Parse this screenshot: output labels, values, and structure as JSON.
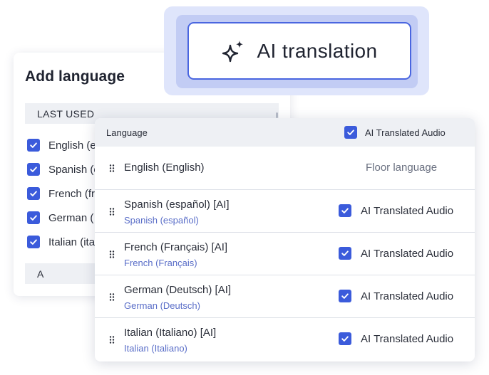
{
  "add_language": {
    "title": "Add language",
    "last_used_header": "LAST USED",
    "alpha_header": "A",
    "items": [
      {
        "label": "English (e",
        "checked": true
      },
      {
        "label": "Spanish (e",
        "checked": true
      },
      {
        "label": "French (fr",
        "checked": true
      },
      {
        "label": "German (",
        "checked": true
      },
      {
        "label": "Italian (ita",
        "checked": true
      }
    ]
  },
  "ai_badge": {
    "label": "AI translation",
    "icon": "sparkle-icon"
  },
  "table": {
    "header": {
      "language": "Language",
      "audio": "AI Translated Audio",
      "audio_checked": true
    },
    "floor_row": {
      "name": "English (English)",
      "status": "Floor language"
    },
    "rows": [
      {
        "name": "Spanish (español) [AI]",
        "native": "Spanish (español)",
        "audio_label": "AI Translated Audio",
        "audio_checked": true
      },
      {
        "name": "French (Français) [AI]",
        "native": "French (Français)",
        "audio_label": "AI Translated Audio",
        "audio_checked": true
      },
      {
        "name": "German (Deutsch) [AI]",
        "native": "German (Deutsch)",
        "audio_label": "AI Translated Audio",
        "audio_checked": true
      },
      {
        "name": "Italian (Italiano) [AI]",
        "native": "Italian (Italiano)",
        "audio_label": "AI Translated Audio",
        "audio_checked": true
      }
    ]
  },
  "colors": {
    "accent": "#3b5bdb",
    "badge_border": "#4a66e0",
    "subtext": "#5a6ec8"
  }
}
